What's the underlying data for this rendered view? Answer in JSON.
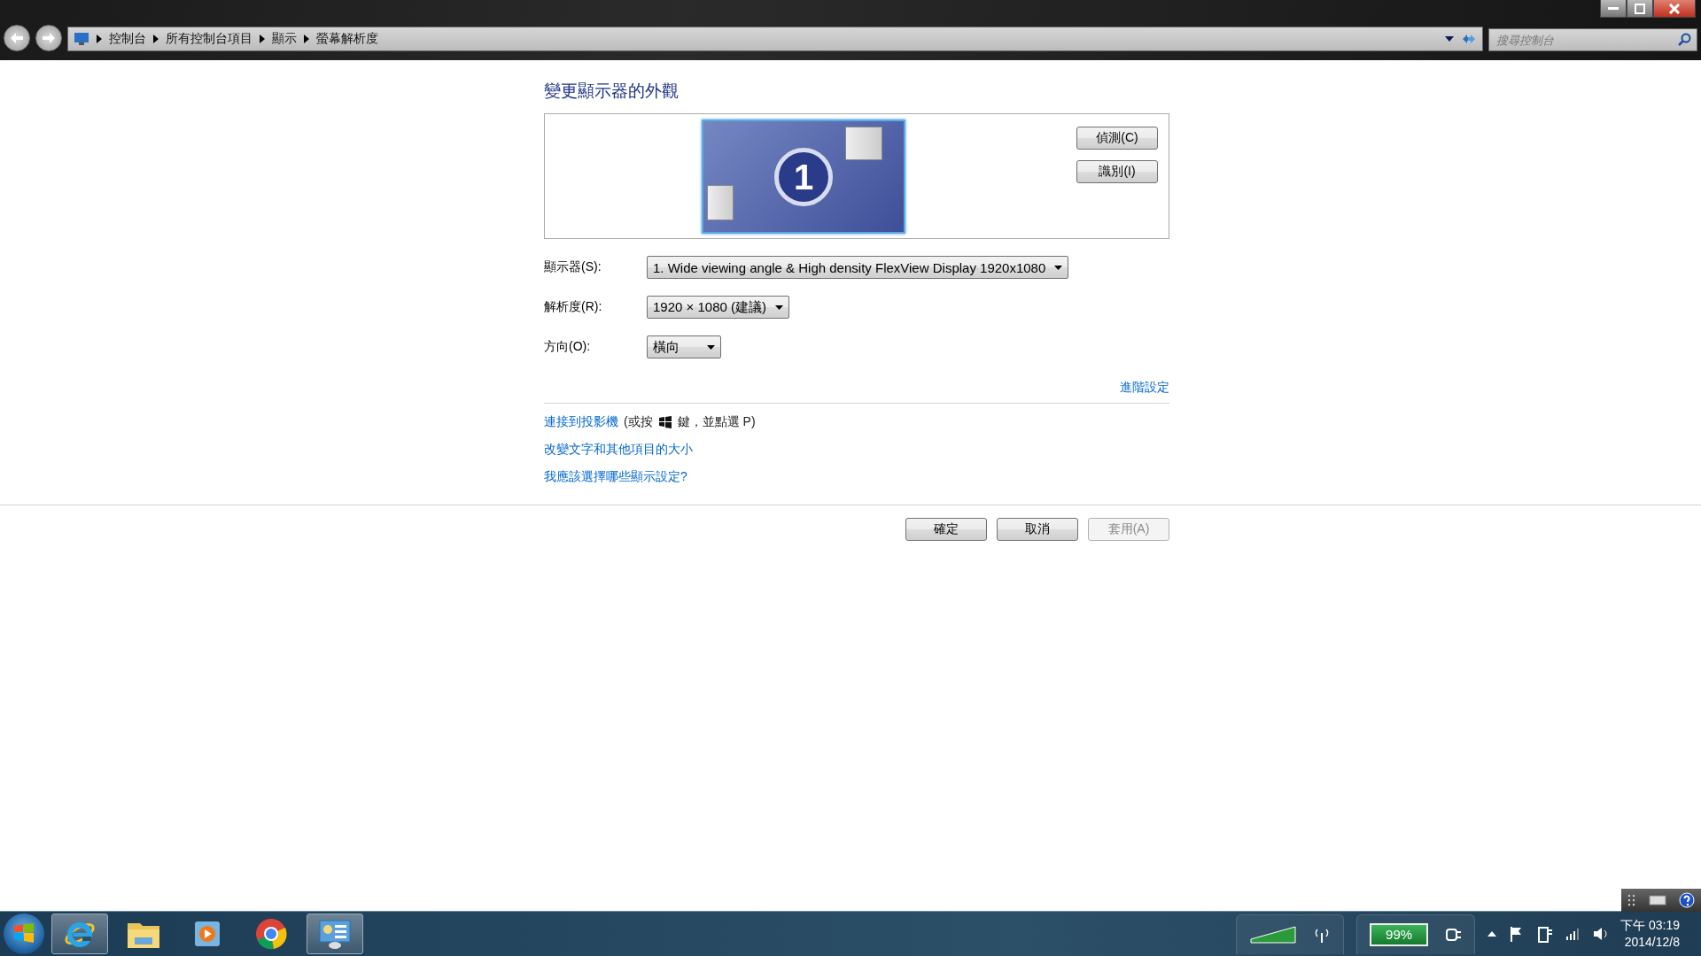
{
  "address_bar": {
    "breadcrumbs": [
      "控制台",
      "所有控制台項目",
      "顯示",
      "螢幕解析度"
    ]
  },
  "search": {
    "placeholder": "搜尋控制台"
  },
  "heading": "變更顯示器的外觀",
  "preview": {
    "monitor_number": "1",
    "buttons": [
      "偵測(C)",
      "識別(I)"
    ]
  },
  "fields": [
    {
      "label": "顯示器(S):",
      "value": "1. Wide viewing angle & High density FlexView Display 1920x1080",
      "kind": "wide"
    },
    {
      "label": "解析度(R):",
      "value": "1920 × 1080 (建議)",
      "kind": "medium"
    },
    {
      "label": "方向(O):",
      "value": "橫向",
      "kind": "narrow"
    }
  ],
  "advanced_link": "進階設定",
  "projector": {
    "link": "連接到投影機",
    "before_key": "(或按",
    "after_key": "鍵，並點選 P)"
  },
  "links": [
    "改變文字和其他項目的大小",
    "我應該選擇哪些顯示設定?"
  ],
  "buttons": [
    {
      "label": "確定",
      "disabled": false
    },
    {
      "label": "取消",
      "disabled": false
    },
    {
      "label": "套用(A)",
      "disabled": true
    }
  ],
  "taskbar": {
    "apps": [
      {
        "kind": "browser",
        "running": true
      },
      {
        "kind": "folder",
        "running": false
      },
      {
        "kind": "media",
        "running": false
      },
      {
        "kind": "chrome",
        "running": false
      },
      {
        "kind": "control-panel",
        "running": true
      }
    ],
    "battery": "99%",
    "time": "下午 03:19",
    "date": "2014/12/8"
  }
}
